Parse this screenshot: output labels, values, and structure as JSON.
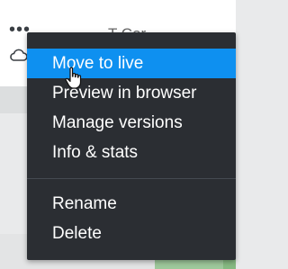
{
  "background": {
    "more_icon": "more-horizontal-icon",
    "cloud_icon": "cloud-icon",
    "heading_fragment": "T              Cor"
  },
  "menu": {
    "items": [
      {
        "label": "Move to live",
        "active": true
      },
      {
        "label": "Preview in browser"
      },
      {
        "label": "Manage versions"
      },
      {
        "label": "Info & stats"
      }
    ],
    "secondary_items": [
      {
        "label": "Rename"
      },
      {
        "label": "Delete"
      }
    ]
  },
  "colors": {
    "menu_bg": "#2b2e33",
    "active_bg": "#0e90f0",
    "text": "#ffffff"
  },
  "cursor": "hand-pointer-icon"
}
